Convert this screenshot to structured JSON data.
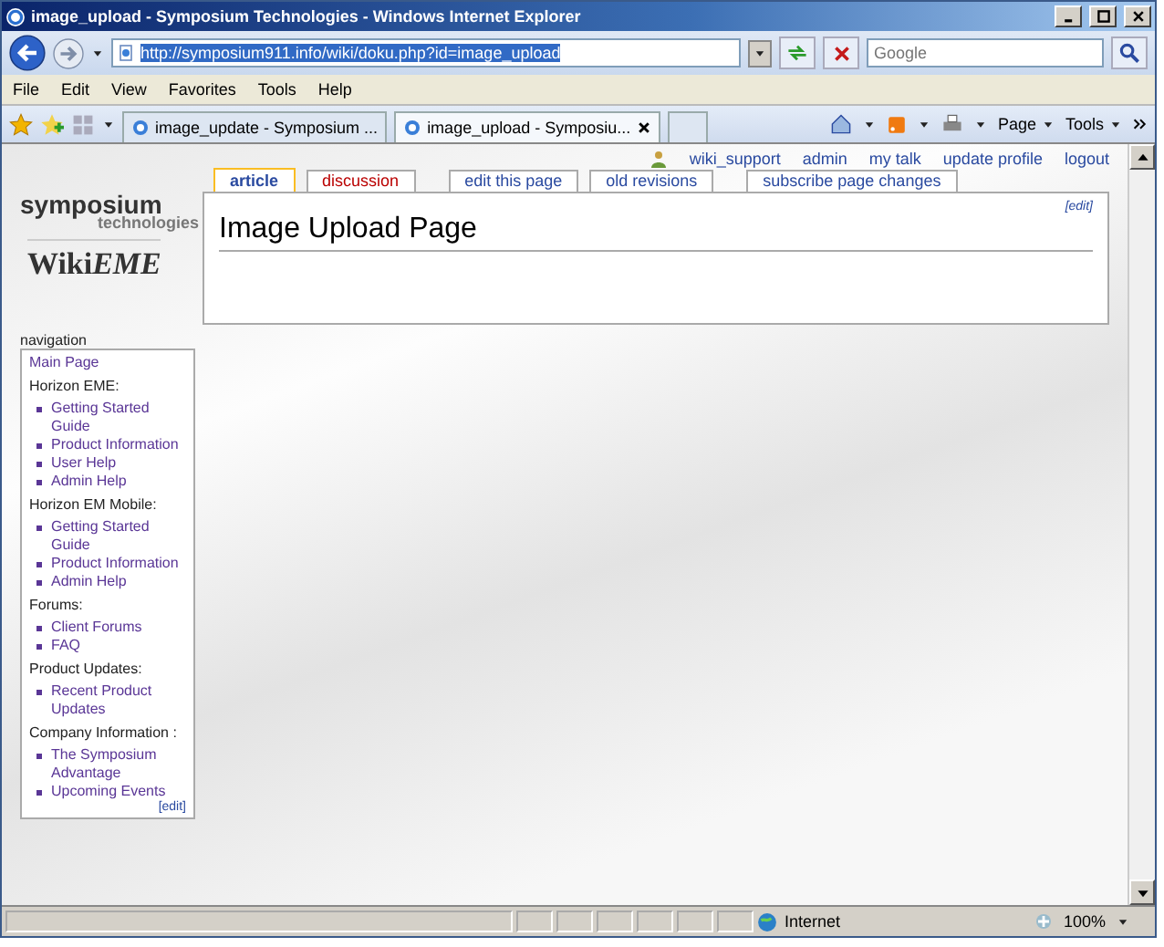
{
  "window": {
    "title": "image_upload - Symposium Technologies - Windows Internet Explorer"
  },
  "address_bar": {
    "url": "http://symposium911.info/wiki/doku.php?id=image_upload"
  },
  "search": {
    "placeholder": "Google"
  },
  "menu": [
    "File",
    "Edit",
    "View",
    "Favorites",
    "Tools",
    "Help"
  ],
  "browser_tabs": [
    {
      "label": "image_update - Symposium ...",
      "selected": false
    },
    {
      "label": "image_upload - Symposiu...",
      "selected": true
    }
  ],
  "command_bar": [
    "Page",
    "Tools"
  ],
  "user_links": [
    "wiki_support",
    "admin",
    "my talk",
    "update profile",
    "logout"
  ],
  "page_tabs": [
    {
      "label": "article",
      "selected": true,
      "new": false
    },
    {
      "label": "discussion",
      "selected": false,
      "new": true
    },
    {
      "label": "edit this page",
      "selected": false,
      "new": false
    },
    {
      "label": "old revisions",
      "selected": false,
      "new": false
    },
    {
      "label": "subscribe page changes",
      "selected": false,
      "new": false
    }
  ],
  "logo": {
    "line1": "symposium",
    "line2": "technologies",
    "wiki": "Wiki",
    "eme": "EME"
  },
  "page": {
    "edit_link": "[edit]",
    "title": "Image Upload Page"
  },
  "sidebar": {
    "heading": "navigation",
    "edit_link": "[edit]",
    "items": [
      {
        "kind": "link",
        "label": "Main Page"
      },
      {
        "kind": "section",
        "label": "Horizon EME:",
        "children": [
          "Getting Started Guide",
          "Product Information",
          "User Help",
          "Admin Help"
        ]
      },
      {
        "kind": "section",
        "label": "Horizon EM Mobile:",
        "children": [
          "Getting Started Guide",
          "Product Information",
          "Admin Help"
        ]
      },
      {
        "kind": "section",
        "label": "Forums:",
        "children": [
          "Client Forums",
          "FAQ"
        ]
      },
      {
        "kind": "section",
        "label": "Product Updates:",
        "children": [
          "Recent Product Updates"
        ]
      },
      {
        "kind": "section",
        "label": "Company Information :",
        "children": [
          "The Symposium Advantage",
          "Upcoming Events"
        ]
      }
    ]
  },
  "status_bar": {
    "zone": "Internet",
    "zoom": "100%"
  }
}
